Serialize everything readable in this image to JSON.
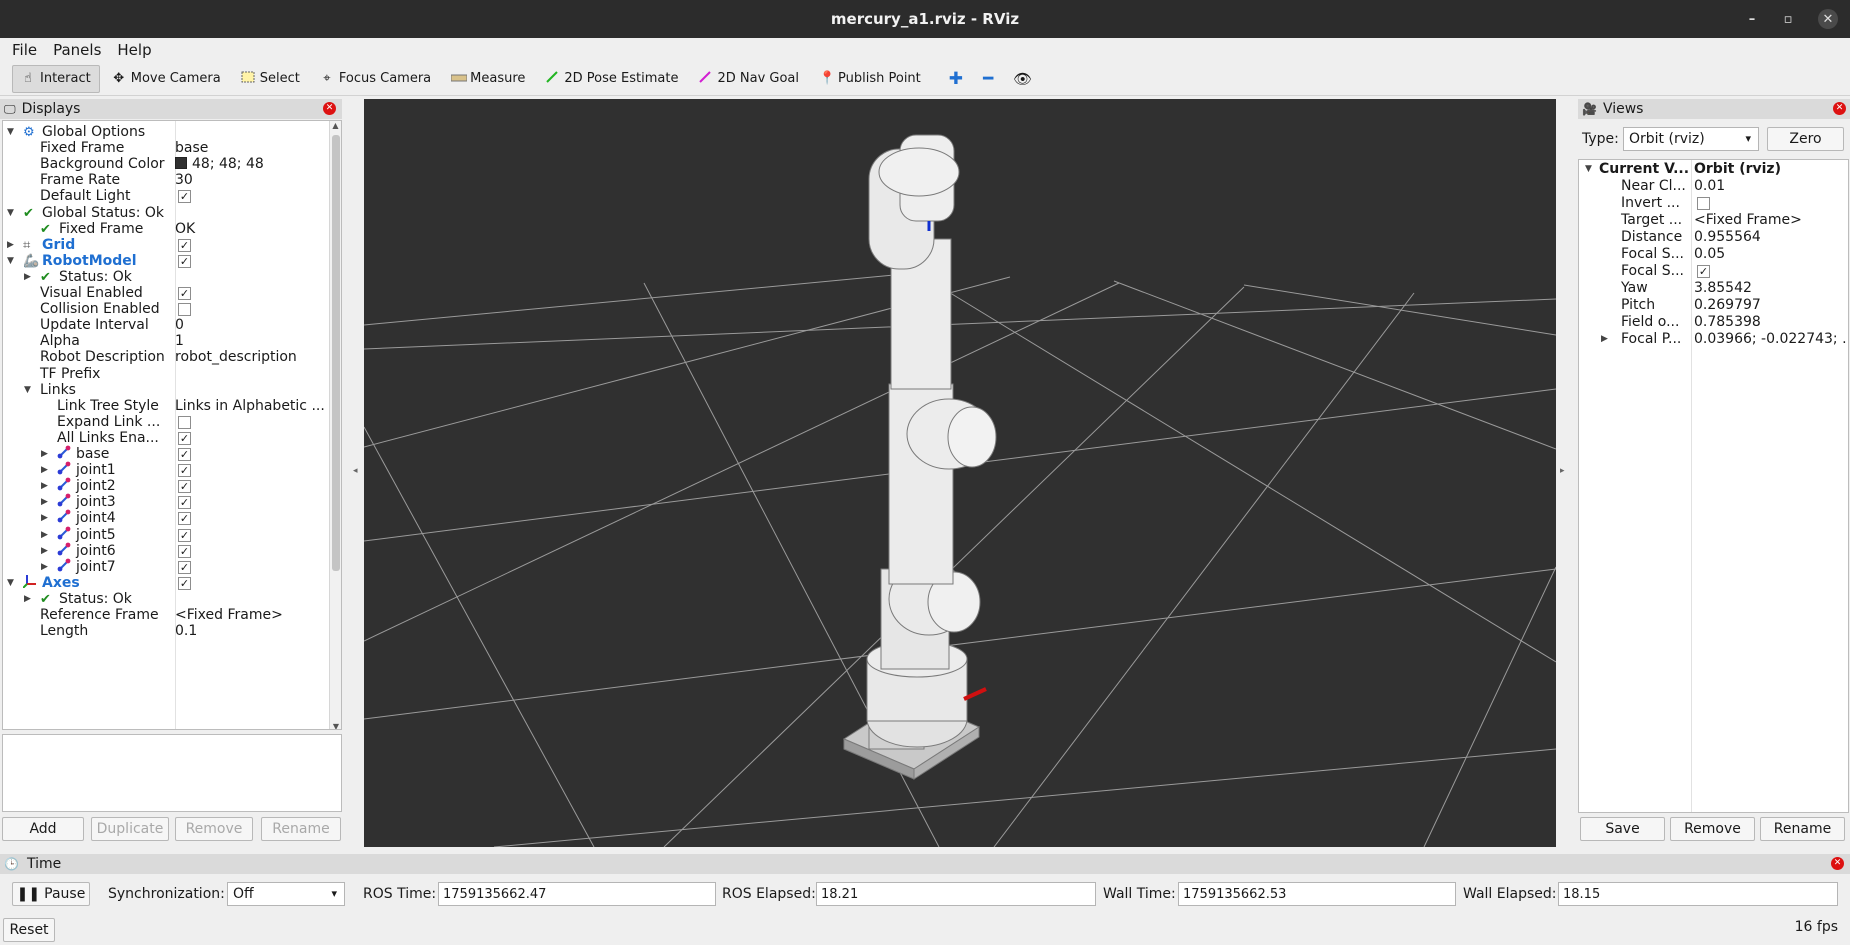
{
  "window": {
    "title": "mercury_a1.rviz - RViz",
    "min": "–",
    "max": "▫",
    "close": "✕"
  },
  "menu": [
    "File",
    "Panels",
    "Help"
  ],
  "toolbar": {
    "tools": [
      "Interact",
      "Move Camera",
      "Select",
      "Focus Camera",
      "Measure",
      "2D Pose Estimate",
      "2D Nav Goal",
      "Publish Point"
    ],
    "extra_icons": [
      "plus-icon",
      "minus-icon",
      "eye-icon"
    ]
  },
  "displays": {
    "title": "Displays",
    "tree": [
      {
        "name": "Global Options",
        "value": "",
        "indent": 0,
        "toggle": "open",
        "icon": "gear"
      },
      {
        "name": "Fixed Frame",
        "value": "base",
        "indent": 1
      },
      {
        "name": "Background Color",
        "value": "48; 48; 48",
        "indent": 1,
        "swatch": "#303030"
      },
      {
        "name": "Frame Rate",
        "value": "30",
        "indent": 1
      },
      {
        "name": "Default Light",
        "checked": true,
        "indent": 1
      },
      {
        "name": "Global Status: Ok",
        "value": "",
        "indent": 0,
        "toggle": "open",
        "icon": "check"
      },
      {
        "name": "Fixed Frame",
        "value": "OK",
        "indent": 1,
        "icon": "check"
      },
      {
        "name": "Grid",
        "checked": true,
        "indent": 0,
        "toggle": "closed",
        "icon": "grid",
        "blue": true
      },
      {
        "name": "RobotModel",
        "checked": true,
        "indent": 0,
        "toggle": "open",
        "icon": "robot",
        "blue": true
      },
      {
        "name": "Status: Ok",
        "value": "",
        "indent": 1,
        "toggle": "closed",
        "icon": "check"
      },
      {
        "name": "Visual Enabled",
        "checked": true,
        "indent": 1
      },
      {
        "name": "Collision Enabled",
        "checked": false,
        "indent": 1
      },
      {
        "name": "Update Interval",
        "value": "0",
        "indent": 1
      },
      {
        "name": "Alpha",
        "value": "1",
        "indent": 1
      },
      {
        "name": "Robot Description",
        "value": "robot_description",
        "indent": 1
      },
      {
        "name": "TF Prefix",
        "value": "",
        "indent": 1
      },
      {
        "name": "Links",
        "value": "",
        "indent": 1,
        "toggle": "open"
      },
      {
        "name": "Link Tree Style",
        "value": "Links in Alphabetic ...",
        "indent": 2
      },
      {
        "name": "Expand Link ...",
        "checked": false,
        "indent": 2
      },
      {
        "name": "All Links Ena...",
        "checked": true,
        "indent": 2
      },
      {
        "name": "base",
        "checked": true,
        "indent": 2,
        "toggle": "closed",
        "icon": "link"
      },
      {
        "name": "joint1",
        "checked": true,
        "indent": 2,
        "toggle": "closed",
        "icon": "link"
      },
      {
        "name": "joint2",
        "checked": true,
        "indent": 2,
        "toggle": "closed",
        "icon": "link"
      },
      {
        "name": "joint3",
        "checked": true,
        "indent": 2,
        "toggle": "closed",
        "icon": "link"
      },
      {
        "name": "joint4",
        "checked": true,
        "indent": 2,
        "toggle": "closed",
        "icon": "link"
      },
      {
        "name": "joint5",
        "checked": true,
        "indent": 2,
        "toggle": "closed",
        "icon": "link"
      },
      {
        "name": "joint6",
        "checked": true,
        "indent": 2,
        "toggle": "closed",
        "icon": "link"
      },
      {
        "name": "joint7",
        "checked": true,
        "indent": 2,
        "toggle": "closed",
        "icon": "link"
      },
      {
        "name": "Axes",
        "checked": true,
        "indent": 0,
        "toggle": "open",
        "icon": "axes",
        "blue": true
      },
      {
        "name": "Status: Ok",
        "value": "",
        "indent": 1,
        "toggle": "closed",
        "icon": "check"
      },
      {
        "name": "Reference Frame",
        "value": "<Fixed Frame>",
        "indent": 1
      },
      {
        "name": "Length",
        "value": "0.1",
        "indent": 1
      }
    ],
    "buttons": {
      "add": "Add",
      "duplicate": "Duplicate",
      "remove": "Remove",
      "rename": "Rename"
    }
  },
  "views": {
    "title": "Views",
    "type_label": "Type:",
    "type_value": "Orbit (rviz)",
    "zero": "Zero",
    "header_name": "Current V...",
    "header_value": "Orbit (rviz)",
    "props": [
      {
        "name": "Near Cl...",
        "value": "0.01"
      },
      {
        "name": "Invert ...",
        "checked": false
      },
      {
        "name": "Target ...",
        "value": "<Fixed Frame>"
      },
      {
        "name": "Distance",
        "value": "0.955564"
      },
      {
        "name": "Focal S...",
        "value": "0.05"
      },
      {
        "name": "Focal S...",
        "checked": true
      },
      {
        "name": "Yaw",
        "value": "3.85542"
      },
      {
        "name": "Pitch",
        "value": "0.269797"
      },
      {
        "name": "Field o...",
        "value": "0.785398"
      },
      {
        "name": "Focal P...",
        "value": "0.03966; -0.022743; ...",
        "toggle": "closed"
      }
    ],
    "buttons": {
      "save": "Save",
      "remove": "Remove",
      "rename": "Rename"
    }
  },
  "time": {
    "title": "Time",
    "pause": "Pause",
    "sync_label": "Synchronization:",
    "sync_value": "Off",
    "ros_time_label": "ROS Time:",
    "ros_time": "1759135662.47",
    "ros_elapsed_label": "ROS Elapsed:",
    "ros_elapsed": "18.21",
    "wall_time_label": "Wall Time:",
    "wall_time": "1759135662.53",
    "wall_elapsed_label": "Wall Elapsed:",
    "wall_elapsed": "18.15"
  },
  "status": {
    "reset": "Reset",
    "fps": "16 fps"
  },
  "colors": {
    "viewport_bg": "#303030",
    "grid": "#a0a0a0",
    "robot": "#d8d8d8",
    "accent_blue": "#1f6fd1"
  }
}
